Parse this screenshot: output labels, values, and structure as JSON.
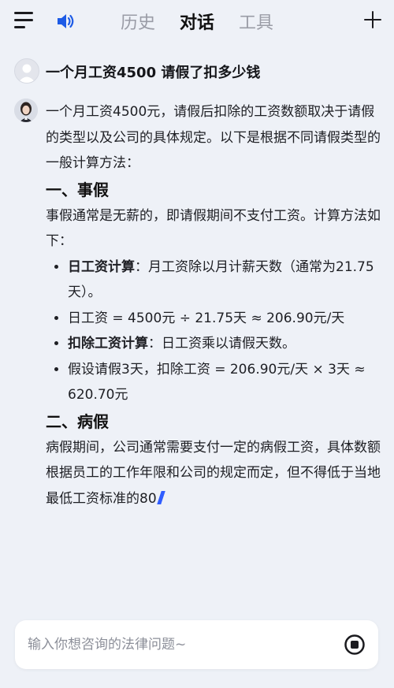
{
  "header": {
    "tabs": [
      {
        "label": "历史",
        "active": false
      },
      {
        "label": "对话",
        "active": true
      },
      {
        "label": "工具",
        "active": false
      }
    ],
    "menu_icon": "hamburger-menu-icon",
    "speaker_icon": "speaker-icon",
    "new_chat_icon": "plus-icon"
  },
  "conversation": {
    "user_message": "一个月工资4500 请假了扣多少钱",
    "answer": {
      "intro": "一个月工资4500元，请假后扣除的工资数额取决于请假的类型以及公司的具体规定。以下是根据不同请假类型的一般计算方法：",
      "section1": {
        "heading": "一、事假",
        "text": "事假通常是无薪的，即请假期间不支付工资。计算方法如下：",
        "bullets": [
          {
            "bold": "日工资计算",
            "text": "：月工资除以月计薪天数（通常为21.75天）。"
          },
          {
            "bold": "",
            "text": "日工资 = 4500元 ÷ 21.75天 ≈ 206.90元/天"
          },
          {
            "bold": "扣除工资计算",
            "text": "：日工资乘以请假天数。"
          },
          {
            "bold": "",
            "text": "假设请假3天，扣除工资 = 206.90元/天 × 3天 ≈ 620.70元"
          }
        ]
      },
      "section2": {
        "heading": "二、病假",
        "text": "病假期间，公司通常需要支付一定的病假工资，具体数额根据员工的工作年限和公司的规定而定，但不得低于当地最低工资标准的80"
      }
    }
  },
  "input": {
    "placeholder": "输入你想咨询的法律问题~",
    "value": ""
  },
  "colors": {
    "background": "#eef1f7",
    "accent": "#2f5dff",
    "tab_inactive": "#9a9ca6"
  }
}
